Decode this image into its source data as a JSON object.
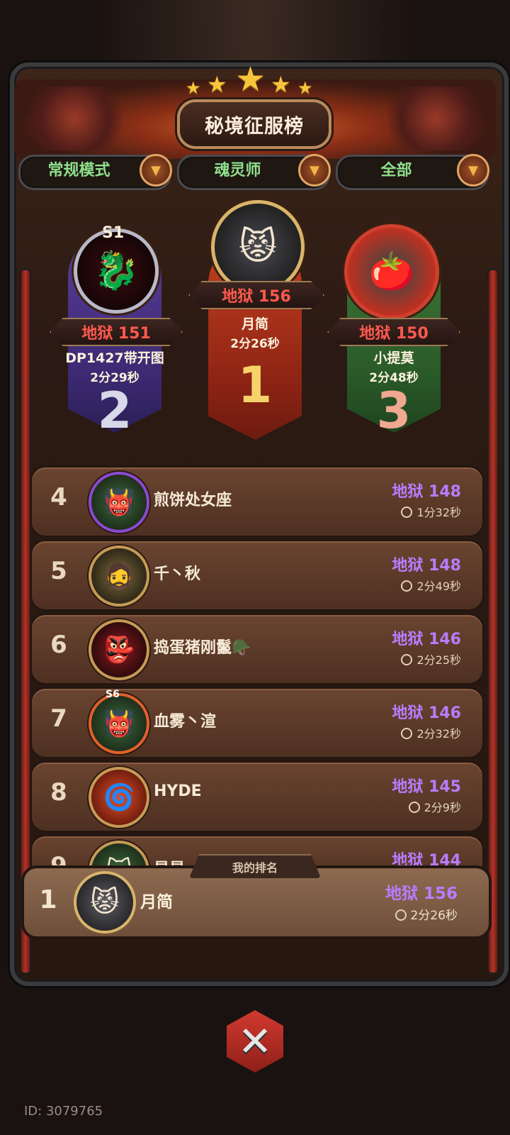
{
  "header": {
    "title": "秘境征服榜"
  },
  "filters": [
    {
      "label": "常规模式"
    },
    {
      "label": "魂灵师"
    },
    {
      "label": "全部"
    }
  ],
  "podium": [
    {
      "rank": "2",
      "badge": "S1",
      "level": "地狱 151",
      "name": "DP1427带开图",
      "time": "2分29秒",
      "color": "#5a3d9a"
    },
    {
      "rank": "1",
      "level": "地狱 156",
      "name": "月简",
      "time": "2分26秒",
      "color": "#c3401f"
    },
    {
      "rank": "3",
      "level": "地狱 150",
      "name": "小提莫",
      "time": "2分48秒",
      "color": "#3f7a3a"
    }
  ],
  "list": [
    {
      "rank": "4",
      "name": "煎饼处女座",
      "level": "地狱 148",
      "time": "1分32秒"
    },
    {
      "rank": "5",
      "name": "千丶秋",
      "level": "地狱 148",
      "time": "2分49秒"
    },
    {
      "rank": "6",
      "name": "捣蛋猪刚鬣🪖",
      "level": "地狱 146",
      "time": "2分25秒"
    },
    {
      "rank": "7",
      "badge": "S6",
      "name": "血雾丶渲",
      "level": "地狱 146",
      "time": "2分32秒"
    },
    {
      "rank": "8",
      "name": "HYDE",
      "level": "地狱 145",
      "time": "2分9秒"
    },
    {
      "rank": "9",
      "name": "星星",
      "level": "地狱 144",
      "time": ""
    }
  ],
  "my_rank": {
    "tab_label": "我的排名",
    "rank": "1",
    "name": "月简",
    "level": "地狱 156",
    "time": "2分26秒"
  },
  "footer": {
    "user_id": "ID: 3079765"
  },
  "colors": {
    "accent_purple": "#b97cff",
    "filter_green": "#8fe08c",
    "danger_red": "#ff5a4e"
  },
  "icons": [
    "chevron-down-icon",
    "clock-icon",
    "close-icon",
    "star-icon"
  ]
}
